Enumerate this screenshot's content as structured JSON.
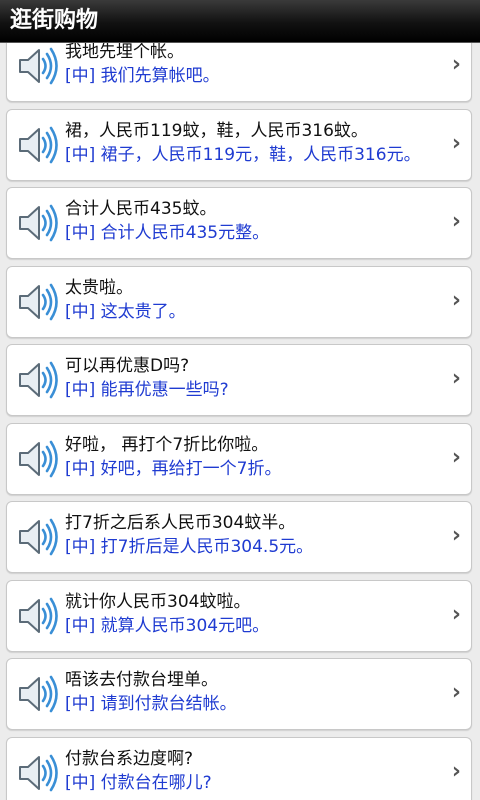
{
  "app": {
    "title": "逛街购物"
  },
  "icons": {
    "row_icon": "speaker-icon",
    "row_arrow": "chevron-right-icon",
    "chevron_glyph": "›"
  },
  "phrases": [
    {
      "cantonese": "我地先埋个帐。",
      "mandarin": "[中] 我们先算帐吧。"
    },
    {
      "cantonese": "裙，人民币119蚊，鞋，人民币316蚊。",
      "mandarin": "[中] 裙子，人民币119元，鞋，人民币316元。"
    },
    {
      "cantonese": "合计人民币435蚊。",
      "mandarin": "[中] 合计人民币435元整。"
    },
    {
      "cantonese": "太贵啦。",
      "mandarin": "[中] 这太贵了。"
    },
    {
      "cantonese": "可以再优惠D吗?",
      "mandarin": "[中] 能再优惠一些吗?"
    },
    {
      "cantonese": "好啦， 再打个7折比你啦。",
      "mandarin": "[中] 好吧，再给打一个7折。"
    },
    {
      "cantonese": "打7折之后系人民币304蚊半。",
      "mandarin": "[中] 打7折后是人民币304.5元。"
    },
    {
      "cantonese": "就计你人民币304蚊啦。",
      "mandarin": "[中] 就算人民币304元吧。"
    },
    {
      "cantonese": "唔该去付款台埋单。",
      "mandarin": "[中] 请到付款台结帐。"
    },
    {
      "cantonese": "付款台系边度啊?",
      "mandarin": "[中] 付款台在哪儿?"
    }
  ]
}
